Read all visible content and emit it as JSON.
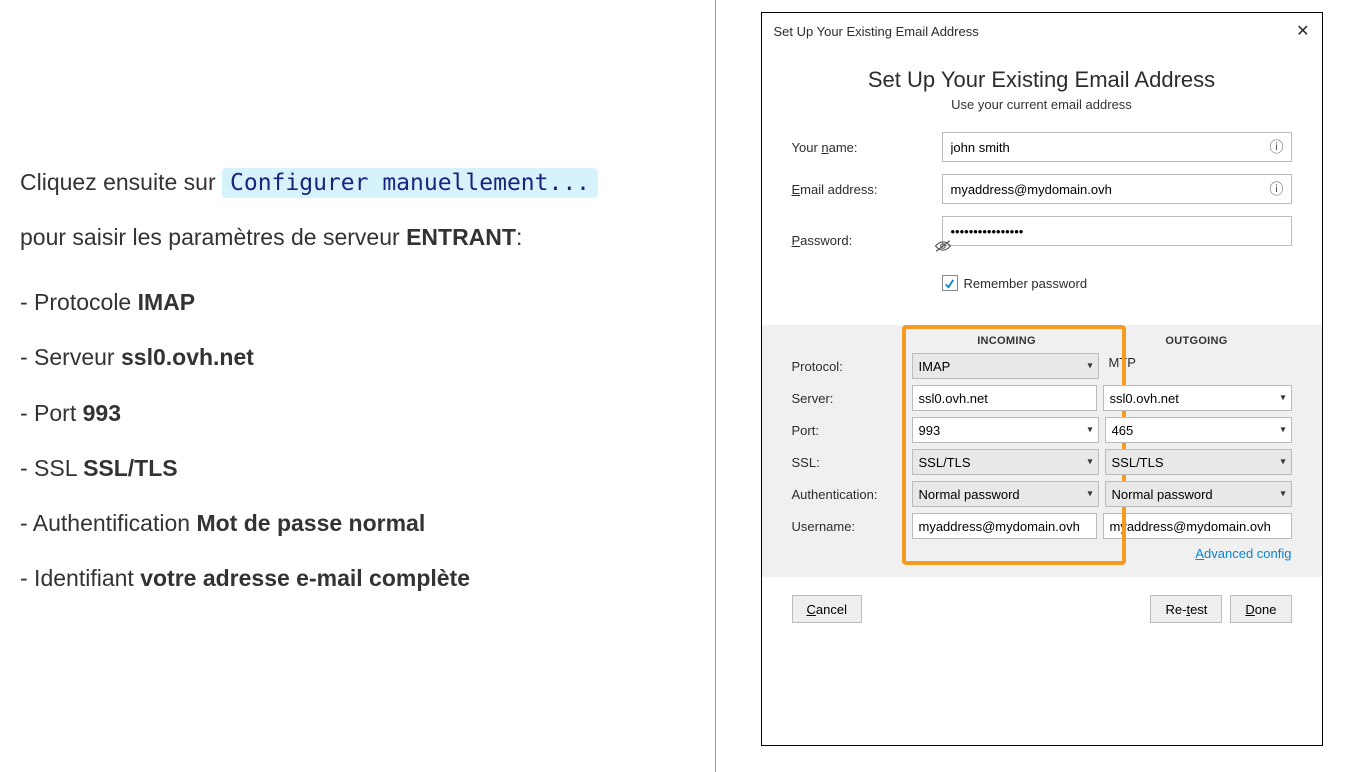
{
  "instructions": {
    "line1_prefix": "Cliquez ensuite sur ",
    "code": "Configurer manuellement...",
    "line2_prefix": "pour saisir les paramètres de serveur ",
    "line2_bold": "ENTRANT",
    "line2_suffix": ":",
    "items": {
      "protocol_label": "- Protocole ",
      "protocol_value": "IMAP",
      "server_label": "- Serveur ",
      "server_value": "ssl0.ovh.net",
      "port_label": "- Port ",
      "port_value": "993",
      "ssl_label": "- SSL ",
      "ssl_value": "SSL/TLS",
      "auth_label": "- Authentification ",
      "auth_value": "Mot de passe normal",
      "ident_label": "- Identifiant ",
      "ident_value": "votre adresse e-mail complète"
    }
  },
  "dialog": {
    "titlebar": "Set Up Your Existing Email Address",
    "heading": "Set Up Your Existing Email Address",
    "subheading": "Use your current email address",
    "labels": {
      "name_pre": "Your ",
      "name_ul": "n",
      "name_post": "ame:",
      "email_pre": "",
      "email_ul": "E",
      "email_post": "mail address:",
      "pass_pre": "",
      "pass_ul": "P",
      "pass_post": "assword:",
      "remember_pre": "Re",
      "remember_ul": "m",
      "remember_post": "ember password"
    },
    "fields": {
      "name": "john smith",
      "email": "myaddress@mydomain.ovh",
      "password": "••••••••••••••••"
    },
    "server": {
      "head_incoming": "INCOMING",
      "head_outgoing": "OUTGOING",
      "rows": {
        "protocol": "Protocol:",
        "server": "Server:",
        "port": "Port:",
        "ssl": "SSL:",
        "auth": "Authentication:",
        "user": "Username:"
      },
      "incoming": {
        "protocol": "IMAP",
        "server": "ssl0.ovh.net",
        "port": "993",
        "ssl": "SSL/TLS",
        "auth": "Normal password",
        "user": "myaddress@mydomain.ovh"
      },
      "outgoing": {
        "protocol": "MTP",
        "server": "ssl0.ovh.net",
        "port": "465",
        "ssl": "SSL/TLS",
        "auth": "Normal password",
        "user": "myaddress@mydomain.ovh"
      },
      "advanced_pre": "",
      "advanced_ul": "A",
      "advanced_post": "dvanced config"
    },
    "buttons": {
      "cancel_ul": "C",
      "cancel_post": "ancel",
      "retest_pre": "Re-",
      "retest_ul": "t",
      "retest_post": "est",
      "done_ul": "D",
      "done_post": "one"
    }
  }
}
